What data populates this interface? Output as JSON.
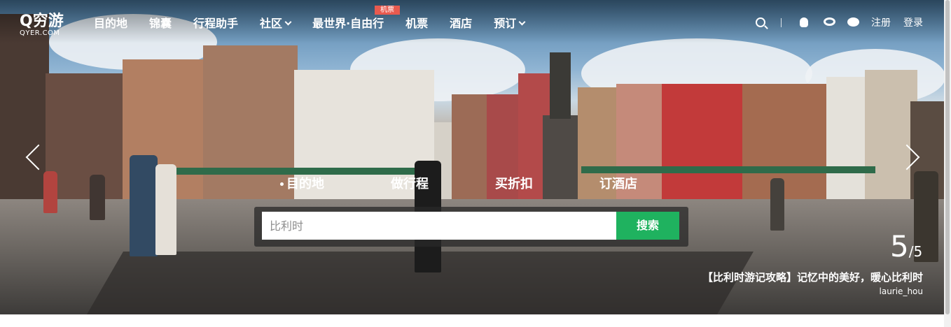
{
  "header": {
    "logo_text": "Q穷游",
    "logo_sub": "QYER.COM",
    "nav": [
      {
        "label": "目的地"
      },
      {
        "label": "锦囊"
      },
      {
        "label": "行程助手"
      },
      {
        "label": "社区"
      },
      {
        "label": "最世界·自由行"
      },
      {
        "label": "机票"
      },
      {
        "label": "酒店"
      },
      {
        "label": "预订"
      }
    ],
    "badge": "机票",
    "register": "注册",
    "login": "登录"
  },
  "search": {
    "tabs": [
      "目的地",
      "做行程",
      "买折扣",
      "订酒店"
    ],
    "placeholder": "比利时",
    "button": "搜索"
  },
  "slider": {
    "current": "5",
    "total": "/5",
    "caption": "【比利时游记攻略】记忆中的美好，暖心比利时",
    "author": "laurie_hou"
  }
}
